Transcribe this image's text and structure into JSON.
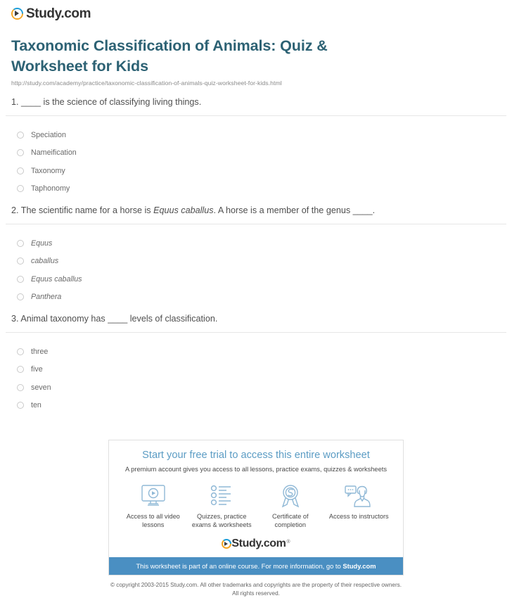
{
  "header": {
    "logo_text": "Study.com",
    "logo_icon": "play-circle-icon"
  },
  "title": "Taxonomic Classification of Animals: Quiz & Worksheet for Kids",
  "url": "http://study.com/academy/practice/taxonomic-classification-of-animals-quiz-worksheet-for-kids.html",
  "questions": [
    {
      "number": "1.",
      "prefix": "",
      "text_before": "____ is the science of classifying living things.",
      "italic": "",
      "text_after": "",
      "italic_options": false,
      "options": [
        "Speciation",
        "Nameification",
        "Taxonomy",
        "Taphonomy"
      ]
    },
    {
      "number": "2.",
      "text_before": "The scientific name for a horse is ",
      "italic": "Equus caballus",
      "text_after": ". A horse is a member of the genus ____.",
      "italic_options": true,
      "options": [
        "Equus",
        "caballus",
        "Equus caballus",
        "Panthera"
      ]
    },
    {
      "number": "3.",
      "text_before": "Animal taxonomy has ____ levels of classification.",
      "italic": "",
      "text_after": "",
      "italic_options": false,
      "options": [
        "three",
        "five",
        "seven",
        "ten"
      ]
    }
  ],
  "promo": {
    "title": "Start your free trial to access this entire worksheet",
    "subtitle": "A premium account gives you access to all lessons, practice exams, quizzes & worksheets",
    "features": [
      {
        "icon": "video-monitor-icon",
        "label": "Access to all video lessons"
      },
      {
        "icon": "checklist-icon",
        "label": "Quizzes, practice exams & worksheets"
      },
      {
        "icon": "award-ribbon-icon",
        "label": "Certificate of completion"
      },
      {
        "icon": "instructor-chat-icon",
        "label": "Access to instructors"
      }
    ],
    "logo_text": "Study.com",
    "trademark": "®",
    "bar_text_before": "This worksheet is part of an online course. For more information, go to ",
    "bar_link_text": "Study.com"
  },
  "footer": {
    "line1": "© copyright 2003-2015 Study.com. All other trademarks and copyrights are the property of their respective owners.",
    "line2": "All rights reserved."
  },
  "colors": {
    "title": "#2d6274",
    "promo_title": "#5b9cc4",
    "promo_bar": "#4a8fc2",
    "rule": "#e6e6e6",
    "icon_stroke": "#8fb8d6"
  }
}
